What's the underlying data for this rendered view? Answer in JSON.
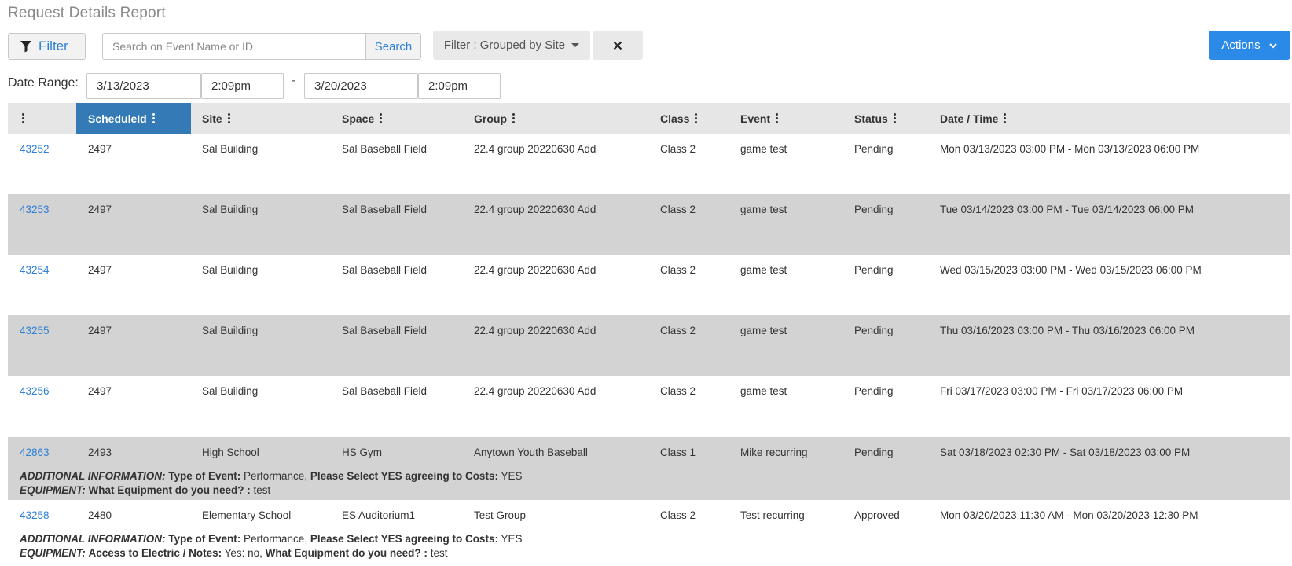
{
  "page": {
    "title": "Request Details Report"
  },
  "toolbar": {
    "filter_label": "Filter",
    "search_placeholder": "Search on Event Name or ID",
    "search_label": "Search",
    "group_filter_label": "Filter : Grouped by Site",
    "actions_label": "Actions"
  },
  "date_range": {
    "label": "Date Range:",
    "start_date": "3/13/2023",
    "start_time": "2:09pm",
    "separator": "-",
    "end_date": "3/20/2023",
    "end_time": "2:09pm"
  },
  "table": {
    "columns": [
      "",
      "ScheduleId",
      "Site",
      "Space",
      "Group",
      "Class",
      "Event",
      "Status",
      "Date / Time"
    ],
    "active_column": "ScheduleId",
    "rows": [
      {
        "id": "43252",
        "schedule_id": "2497",
        "site": "Sal Building",
        "space": "Sal Baseball Field",
        "group": "22.4 group 20220630 Add",
        "class": "Class 2",
        "event": "game test",
        "status": "Pending",
        "datetime": "Mon 03/13/2023 03:00 PM - Mon 03/13/2023 06:00 PM"
      },
      {
        "id": "43253",
        "schedule_id": "2497",
        "site": "Sal Building",
        "space": "Sal Baseball Field",
        "group": "22.4 group 20220630 Add",
        "class": "Class 2",
        "event": "game test",
        "status": "Pending",
        "datetime": "Tue 03/14/2023 03:00 PM - Tue 03/14/2023 06:00 PM"
      },
      {
        "id": "43254",
        "schedule_id": "2497",
        "site": "Sal Building",
        "space": "Sal Baseball Field",
        "group": "22.4 group 20220630 Add",
        "class": "Class 2",
        "event": "game test",
        "status": "Pending",
        "datetime": "Wed 03/15/2023 03:00 PM - Wed 03/15/2023 06:00 PM"
      },
      {
        "id": "43255",
        "schedule_id": "2497",
        "site": "Sal Building",
        "space": "Sal Baseball Field",
        "group": "22.4 group 20220630 Add",
        "class": "Class 2",
        "event": "game test",
        "status": "Pending",
        "datetime": "Thu 03/16/2023 03:00 PM - Thu 03/16/2023 06:00 PM"
      },
      {
        "id": "43256",
        "schedule_id": "2497",
        "site": "Sal Building",
        "space": "Sal Baseball Field",
        "group": "22.4 group 20220630 Add",
        "class": "Class 2",
        "event": "game test",
        "status": "Pending",
        "datetime": "Fri 03/17/2023 03:00 PM - Fri 03/17/2023 06:00 PM"
      },
      {
        "id": "42863",
        "schedule_id": "2493",
        "site": "High School",
        "space": "HS Gym",
        "group": "Anytown Youth Baseball",
        "class": "Class 1",
        "event": "Mike recurring",
        "status": "Pending",
        "datetime": "Sat 03/18/2023 02:30 PM - Sat 03/18/2023 03:00 PM",
        "additional_info": {
          "label": "ADDITIONAL INFORMATION:",
          "q1": "Type of Event:",
          "a1": "Performance,",
          "q2": "Please Select YES agreeing to Costs:",
          "a2": "YES"
        },
        "equipment": {
          "label": "EQUIPMENT:",
          "q1": "What Equipment do you need? :",
          "a1": "test"
        }
      },
      {
        "id": "43258",
        "schedule_id": "2480",
        "site": "Elementary School",
        "space": "ES Auditorium1",
        "group": "Test Group",
        "class": "Class 2",
        "event": "Test recurring",
        "status": "Approved",
        "datetime": "Mon 03/20/2023 11:30 AM - Mon 03/20/2023 12:30 PM",
        "additional_info": {
          "label": "ADDITIONAL INFORMATION:",
          "q1": "Type of Event:",
          "a1": "Performance,",
          "q2": "Please Select YES agreeing to Costs:",
          "a2": "YES"
        },
        "equipment": {
          "label": "EQUIPMENT:",
          "q1": "Access to Electric / Notes:",
          "a1": "Yes: no,",
          "q2": "What Equipment do you need? :",
          "a2": "test"
        }
      }
    ]
  },
  "colors": {
    "accent": "#2b8ae8",
    "active_header": "#337ab7",
    "link": "#2e7fd6",
    "alt_row": "#d3d3d3"
  }
}
